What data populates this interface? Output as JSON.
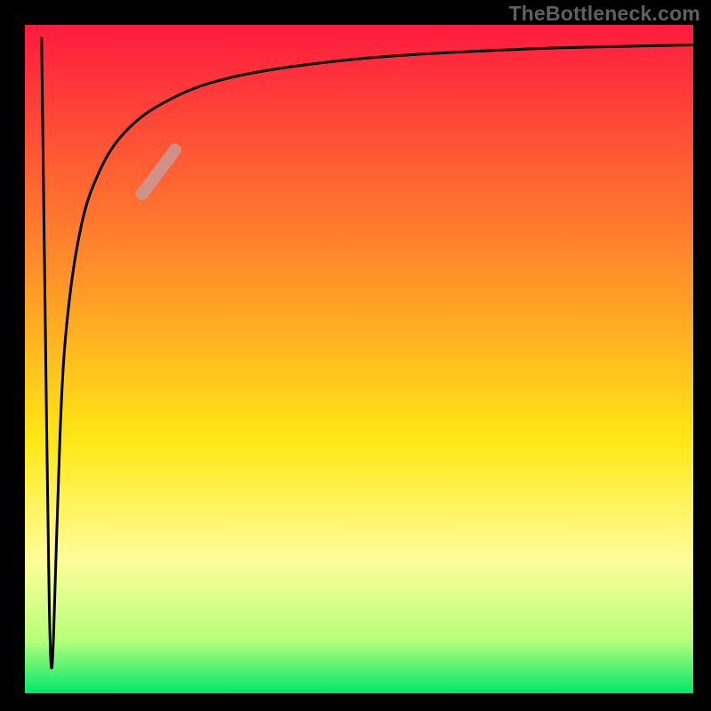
{
  "watermark": "TheBottleneck.com",
  "chart_data": {
    "type": "line",
    "title": "",
    "xlabel": "",
    "ylabel": "",
    "xlim": [
      0,
      100
    ],
    "ylim": [
      0,
      100
    ],
    "grid": false,
    "background_gradient": {
      "direction": "vertical",
      "stops": [
        {
          "pos": 0.0,
          "color": "#ff1a3f"
        },
        {
          "pos": 0.35,
          "color": "#ff8a2b"
        },
        {
          "pos": 0.62,
          "color": "#ffe714"
        },
        {
          "pos": 0.8,
          "color": "#fffd9a"
        },
        {
          "pos": 0.92,
          "color": "#b8ff7a"
        },
        {
          "pos": 1.0,
          "color": "#00e86a"
        }
      ]
    },
    "series": [
      {
        "name": "curve",
        "color": "#000000",
        "x": [
          2.5,
          3.0,
          3.5,
          3.8,
          4.0,
          4.2,
          4.5,
          5.0,
          5.5,
          6.0,
          7.0,
          8.0,
          9.0,
          10.0,
          12.0,
          14.0,
          17.0,
          20.0,
          25.0,
          30.0,
          35.0,
          40.0,
          50.0,
          60.0,
          70.0,
          80.0,
          90.0,
          100.0
        ],
        "y": [
          98.0,
          60.0,
          20.0,
          6.0,
          3.0,
          6.0,
          15.0,
          32.0,
          45.0,
          53.0,
          62.0,
          68.0,
          72.5,
          75.5,
          80.0,
          83.0,
          86.0,
          88.0,
          90.5,
          92.0,
          93.0,
          93.8,
          95.0,
          95.7,
          96.2,
          96.6,
          96.8,
          97.0
        ]
      }
    ],
    "marker": {
      "color": "#c99998",
      "opacity": 0.85,
      "x_range": [
        17.0,
        23.0
      ],
      "y_range": [
        74.0,
        82.0
      ]
    }
  }
}
